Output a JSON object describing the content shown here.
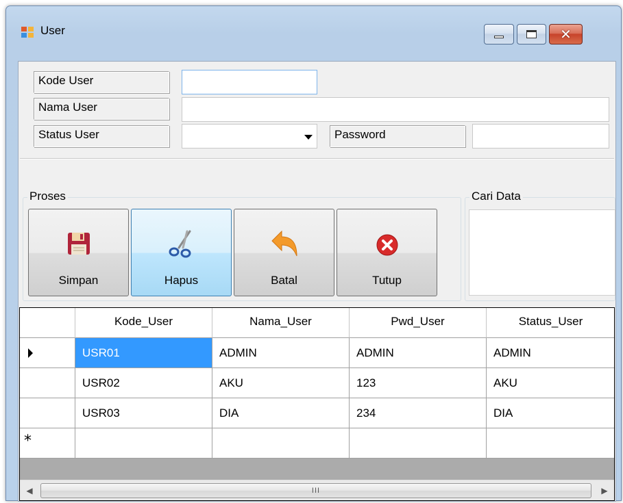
{
  "window": {
    "title": "User"
  },
  "form": {
    "kode_user_label": "Kode User",
    "kode_user_value": "",
    "nama_user_label": "Nama User",
    "nama_user_value": "",
    "status_user_label": "Status User",
    "status_user_value": "",
    "password_label": "Password",
    "password_value": ""
  },
  "proses": {
    "title": "Proses",
    "buttons": [
      {
        "label": "Simpan",
        "icon": "save-icon"
      },
      {
        "label": "Hapus",
        "icon": "scissors-icon"
      },
      {
        "label": "Batal",
        "icon": "undo-arrow-icon"
      },
      {
        "label": "Tutup",
        "icon": "close-circle-icon"
      }
    ]
  },
  "cari": {
    "title": "Cari Data"
  },
  "grid": {
    "columns": [
      "Kode_User",
      "Nama_User",
      "Pwd_User",
      "Status_User"
    ],
    "rows": [
      [
        "USR01",
        "ADMIN",
        "ADMIN",
        "ADMIN"
      ],
      [
        "USR02",
        "AKU",
        "123",
        "AKU"
      ],
      [
        "USR03",
        "DIA",
        "234",
        "DIA"
      ]
    ],
    "selected_cell": "USR01",
    "new_row_marker": "*",
    "scroll_grip": "III"
  },
  "colors": {
    "selection": "#3399ff",
    "active_button": "#bee6fd",
    "close_button": "#c7432b"
  }
}
